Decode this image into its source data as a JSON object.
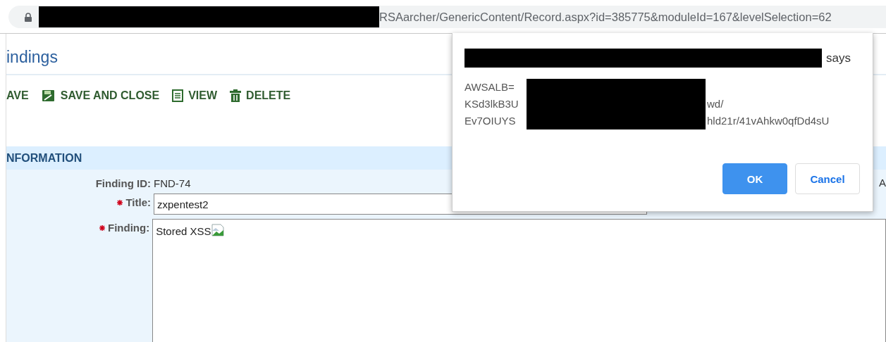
{
  "address_bar": {
    "url": "RSAarcher/GenericContent/Record.aspx?id=385775&moduleId=167&levelSelection=62"
  },
  "page": {
    "title": "indings",
    "toolbar": [
      {
        "kind": "save",
        "label": "AVE"
      },
      {
        "kind": "save_close",
        "label": "SAVE AND CLOSE"
      },
      {
        "kind": "view",
        "label": "VIEW"
      },
      {
        "kind": "delete",
        "label": "DELETE"
      }
    ],
    "section": {
      "title": "NFORMATION",
      "side_text": "A",
      "fields": [
        {
          "kind": "readonly",
          "label": "Finding ID:",
          "required": false,
          "value": "FND-74"
        },
        {
          "kind": "input",
          "label": "Title:",
          "required": true,
          "value": "zxpentest2"
        },
        {
          "kind": "richtext",
          "label": "Finding:",
          "required": true,
          "value": "Stored XSS",
          "broken_image": true
        }
      ]
    }
  },
  "dialog": {
    "title_suffix": "says",
    "lines": [
      {
        "before": "AWSALB="
      },
      {
        "before": "KSd3lkB3U",
        "after": "wd/"
      },
      {
        "before": "Ev7OIUYS",
        "after": "hld21r/41vAhkw0qfDd4sU"
      }
    ],
    "buttons": [
      {
        "label": "OK",
        "primary": true
      },
      {
        "label": "Cancel",
        "primary": false
      }
    ]
  }
}
